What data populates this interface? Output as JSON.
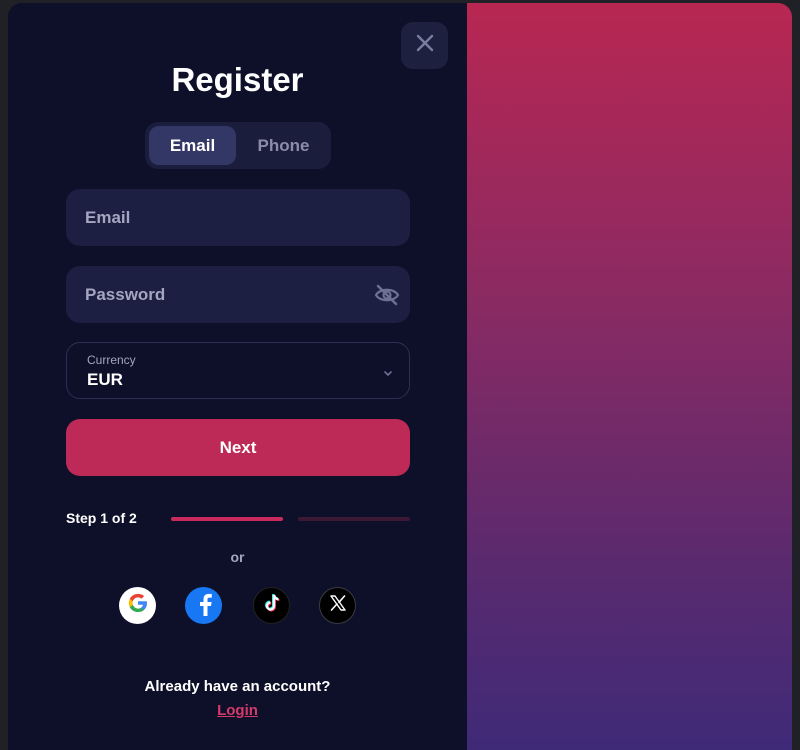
{
  "modal": {
    "title": "Register",
    "close_icon": "close-icon"
  },
  "tabs": [
    {
      "label": "Email",
      "active": true
    },
    {
      "label": "Phone",
      "active": false
    }
  ],
  "form": {
    "email": {
      "placeholder": "Email",
      "value": ""
    },
    "password": {
      "placeholder": "Password",
      "value": "",
      "icon": "eye-off-icon"
    },
    "currency": {
      "label": "Currency",
      "value": "EUR",
      "icon": "chevron-down-icon"
    },
    "next_label": "Next"
  },
  "progress": {
    "label": "Step 1 of 2",
    "current_step": 1,
    "total_steps": 2
  },
  "social": {
    "or_label": "or",
    "providers": [
      "google-icon",
      "facebook-icon",
      "tiktok-icon",
      "x-icon"
    ]
  },
  "footer": {
    "prompt": "Already have an account?",
    "login_label": "Login"
  },
  "colors": {
    "panel": "#0e1029",
    "field": "#1c1e42",
    "accent": "#be2a58",
    "gradient_top": "#b82752",
    "gradient_bottom": "#3f2a78"
  }
}
